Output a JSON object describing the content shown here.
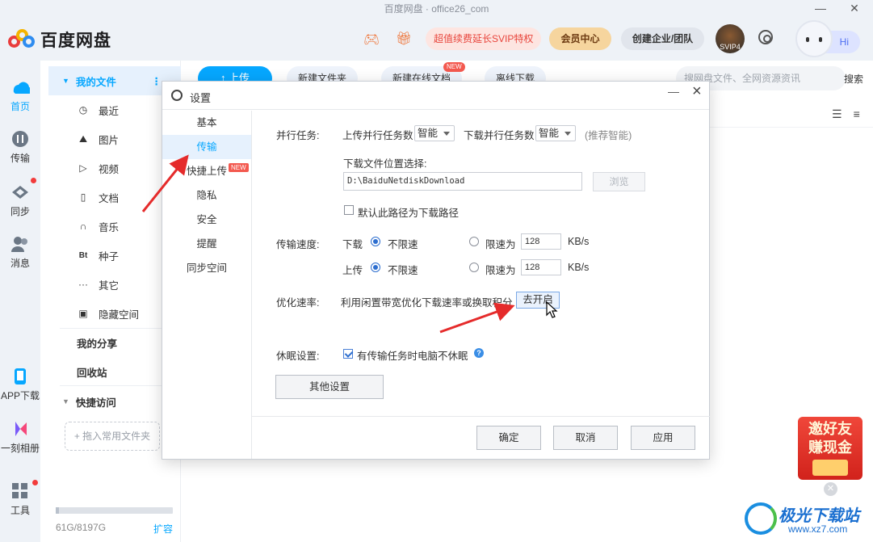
{
  "window": {
    "title": "百度网盘 · office26_com",
    "minimize": "—",
    "close": "✕"
  },
  "header": {
    "logo_text": "百度网盘",
    "promo": "超值续费延长SVIP特权",
    "vip_center": "会员中心",
    "team": "创建企业/团队",
    "svip_badge": "SVIP4",
    "greeting": "Hi",
    "icons": [
      "game-icon",
      "gift-icon",
      "settings-icon"
    ]
  },
  "rail": [
    {
      "label": "首页",
      "icon": "home-icon",
      "active": true
    },
    {
      "label": "传输",
      "icon": "transfer-icon",
      "active": false
    },
    {
      "label": "同步",
      "icon": "sync-icon",
      "active": false
    },
    {
      "label": "消息",
      "icon": "message-icon",
      "active": false
    },
    {
      "label": "APP下载",
      "icon": "phone-icon",
      "active": false
    },
    {
      "label": "一刻相册",
      "icon": "album-icon",
      "active": false
    },
    {
      "label": "工具",
      "icon": "tools-icon",
      "active": false
    }
  ],
  "sidebar": {
    "my_files": "我的文件",
    "items": [
      {
        "label": "最近",
        "icon": "clock-icon",
        "glyph": "◷"
      },
      {
        "label": "图片",
        "icon": "image-icon",
        "glyph": "⛰"
      },
      {
        "label": "视频",
        "icon": "play-icon",
        "glyph": "▷"
      },
      {
        "label": "文档",
        "icon": "doc-icon",
        "glyph": "▯"
      },
      {
        "label": "音乐",
        "icon": "headphone-icon",
        "glyph": "∩"
      },
      {
        "label": "种子",
        "icon": "bt-icon",
        "glyph": "Bt"
      },
      {
        "label": "其它",
        "icon": "more-icon",
        "glyph": "···"
      },
      {
        "label": "隐藏空间",
        "icon": "lock-icon",
        "glyph": "▣"
      }
    ],
    "my_share": "我的分享",
    "recycle": "回收站",
    "quick_access": "快捷访问",
    "add_folder": "+ 拖入常用文件夹",
    "quota_text": "61G/8197G",
    "quota_fraction": 0.0074,
    "expand": "扩容"
  },
  "toolbar": {
    "upload": "↑ 上传",
    "new_folder": "新建文件夹",
    "new_doc": "新建在线文档",
    "new_badge": "NEW",
    "offline": "离线下载",
    "search_placeholder": "搜网盘文件、全网资源资讯",
    "search_btn": "搜索"
  },
  "invite": {
    "line1": "邀好友",
    "line2": "赚现金"
  },
  "watermark": {
    "title": "极光下载站",
    "url": "www.xz7.com"
  },
  "dialog": {
    "title": "设置",
    "nav": [
      "基本",
      "传输",
      "快捷上传",
      "隐私",
      "安全",
      "提醒",
      "同步空间"
    ],
    "nav_active": 1,
    "nav_new": "NEW",
    "parallel": {
      "label": "并行任务:",
      "upload_label": "上传并行任务数",
      "upload_value": "智能",
      "download_label": "下载并行任务数",
      "download_value": "智能",
      "hint": "(推荐智能)"
    },
    "download_path": {
      "label": "下载文件位置选择:",
      "value": "D:\\BaiduNetdiskDownload",
      "browse": "浏览",
      "default_check": "默认此路径为下载路径",
      "default_checked": false
    },
    "speed": {
      "label": "传输速度:",
      "download": "下载",
      "upload": "上传",
      "unlimited": "不限速",
      "limit_to": "限速为",
      "download_limit": "128",
      "upload_limit": "128",
      "unit": "KB/s"
    },
    "optimize": {
      "label": "优化速率:",
      "text": "利用闲置带宽优化下载速率或换取积分",
      "button": "去开启"
    },
    "sleep": {
      "label": "休眠设置:",
      "text": "有传输任务时电脑不休眠",
      "checked": true
    },
    "other": "其他设置",
    "ok": "确定",
    "cancel": "取消",
    "apply": "应用"
  }
}
